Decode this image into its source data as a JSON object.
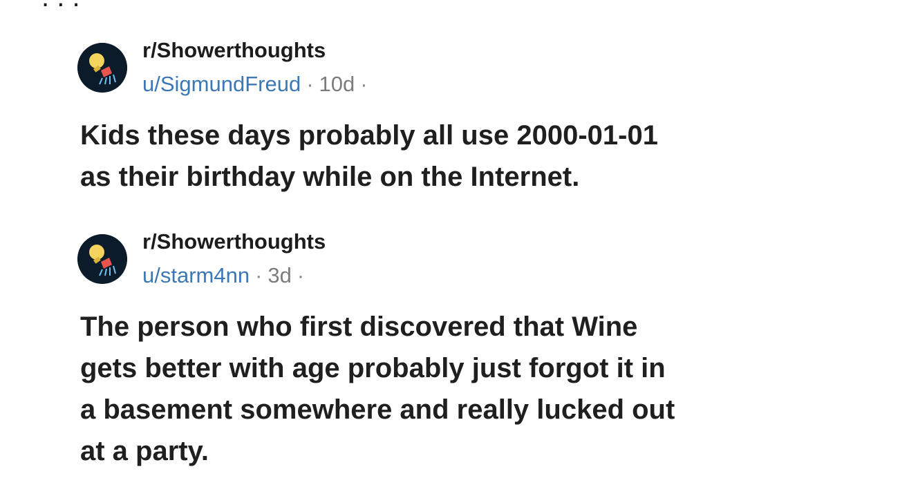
{
  "posts": [
    {
      "subreddit": "r/Showerthoughts",
      "user": "u/SigmundFreud",
      "age": "10d",
      "separator": "·",
      "title_lines": [
        "Kids these days probably all use 2000-01-01",
        "as their birthday while on the Internet."
      ]
    },
    {
      "subreddit": "r/Showerthoughts",
      "user": "u/starm4nn",
      "age": "3d",
      "separator": "·",
      "title_lines": [
        "The person who first discovered that Wine",
        "gets better with age probably just forgot it in",
        "a basement somewhere and really lucked out",
        "at a party."
      ]
    }
  ],
  "avatar_icon": "lightbulb-shower-icon",
  "colors": {
    "username": "#3c77b6",
    "avatar_bg": "#0c1b2a",
    "bulb": "#f4d35e",
    "shower_head": "#e8554e",
    "water": "#6ec3f4"
  }
}
